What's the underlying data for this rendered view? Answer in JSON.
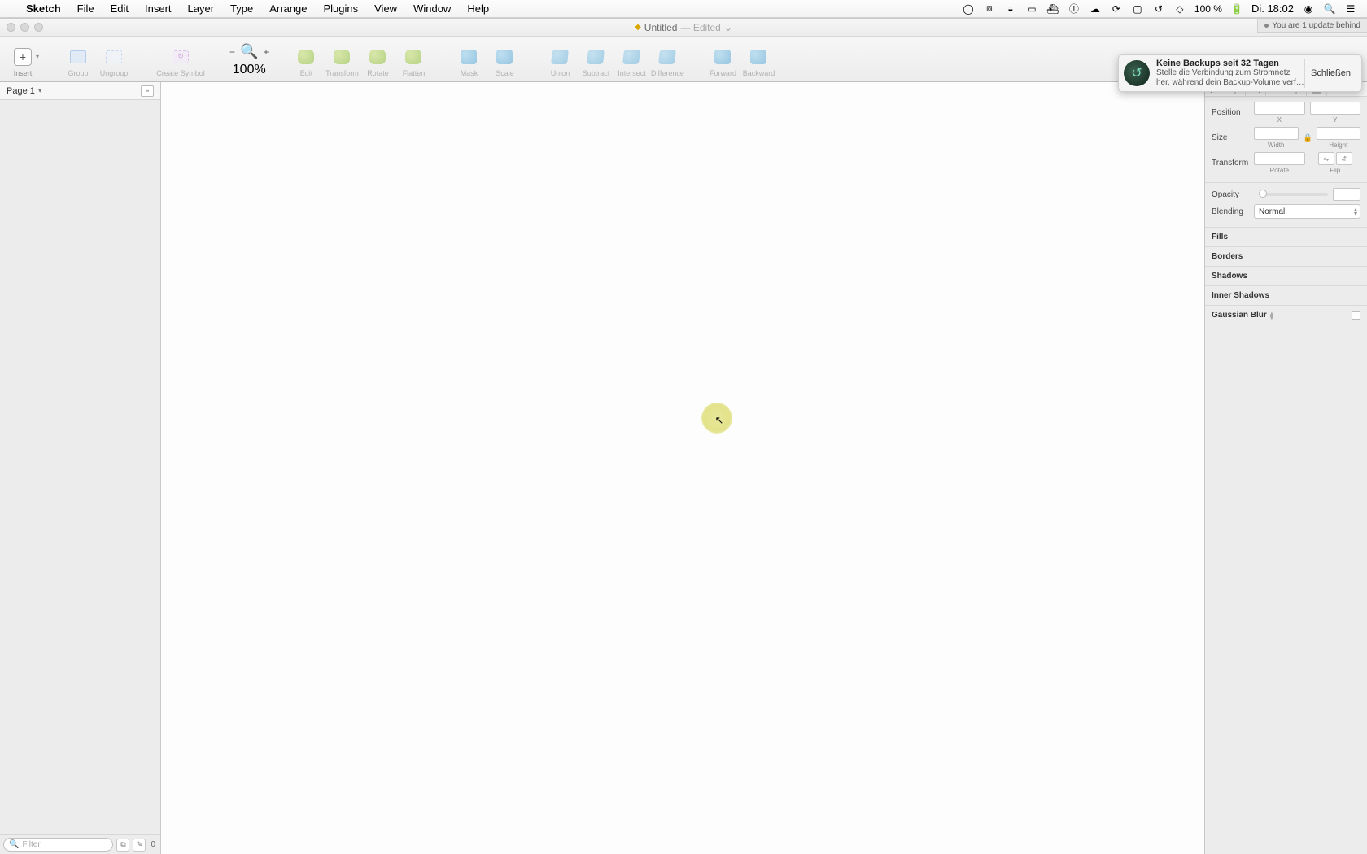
{
  "menubar": {
    "app": "Sketch",
    "items": [
      "File",
      "Edit",
      "Insert",
      "Layer",
      "Type",
      "Arrange",
      "Plugins",
      "View",
      "Window",
      "Help"
    ],
    "battery": "100 %",
    "clock": "Di. 18:02"
  },
  "window": {
    "doc_name": "Untitled",
    "doc_status": "— Edited",
    "update_banner": "You are 1 update behind"
  },
  "toolbar": {
    "insert": "Insert",
    "group": "Group",
    "ungroup": "Ungroup",
    "create_symbol": "Create Symbol",
    "zoom": "100%",
    "edit": "Edit",
    "transform": "Transform",
    "rotate": "Rotate",
    "flatten": "Flatten",
    "mask": "Mask",
    "scale": "Scale",
    "union": "Union",
    "subtract": "Subtract",
    "intersect": "Intersect",
    "difference": "Difference",
    "forward": "Forward",
    "backward": "Backward"
  },
  "sidebar": {
    "page": "Page 1",
    "filter_placeholder": "Filter",
    "layer_count": "0"
  },
  "inspector": {
    "position": "Position",
    "x": "X",
    "y": "Y",
    "size": "Size",
    "width": "Width",
    "height": "Height",
    "transform": "Transform",
    "rotate": "Rotate",
    "flip": "Flip",
    "opacity": "Opacity",
    "blending": "Blending",
    "blending_value": "Normal",
    "fills": "Fills",
    "borders": "Borders",
    "shadows": "Shadows",
    "inner_shadows": "Inner Shadows",
    "gaussian_blur": "Gaussian Blur"
  },
  "notification": {
    "title": "Keine Backups seit 32 Tagen",
    "body": "Stelle die Verbindung zum Stromnetz her, während dein Backup-Volume verf…",
    "close": "Schließen"
  }
}
